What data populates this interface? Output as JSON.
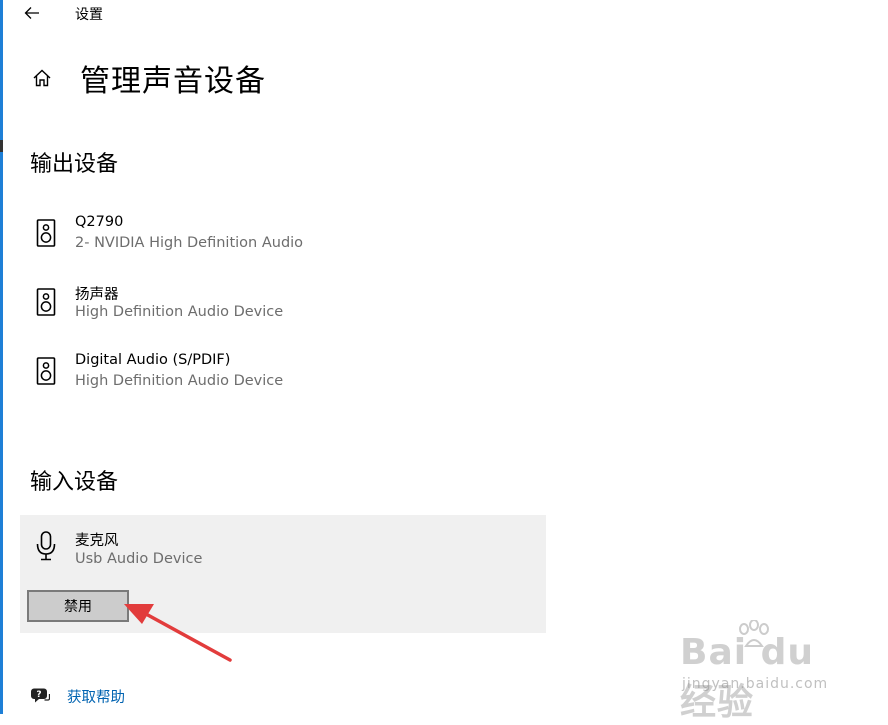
{
  "titlebar": {
    "title": "设置",
    "back_icon": "back-arrow-icon"
  },
  "page": {
    "title": "管理声音设备",
    "home_icon": "home-icon"
  },
  "output_section": {
    "title": "输出设备",
    "devices": [
      {
        "name": "Q2790",
        "sub": "2- NVIDIA High Definition Audio",
        "icon": "speaker-icon"
      },
      {
        "name": "扬声器",
        "sub": "High Definition Audio Device",
        "icon": "speaker-icon"
      },
      {
        "name": "Digital Audio (S/PDIF)",
        "sub": "High Definition Audio Device",
        "icon": "speaker-icon"
      }
    ]
  },
  "input_section": {
    "title": "输入设备",
    "devices": [
      {
        "name": "麦克风",
        "sub": "Usb Audio Device",
        "icon": "microphone-icon",
        "button_label": "禁用"
      }
    ]
  },
  "help": {
    "label": "获取帮助",
    "icon": "help-chat-icon"
  },
  "watermark": {
    "main": "Bai du 经验",
    "sub": "jingyan.baidu.com"
  },
  "colors": {
    "link": "#0063b1",
    "accent_edge": "#1e7fd6",
    "annotation_arrow": "#e23c3c",
    "card_bg": "#f0f0f0"
  }
}
